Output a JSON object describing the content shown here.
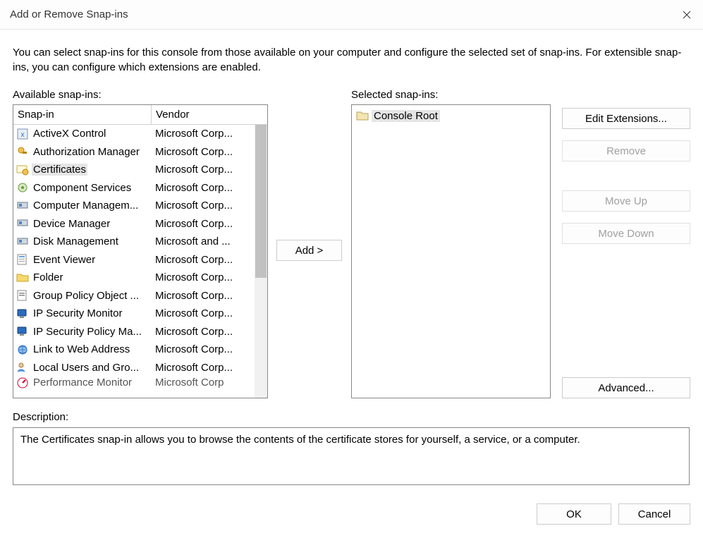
{
  "window": {
    "title": "Add or Remove Snap-ins"
  },
  "intro": "You can select snap-ins for this console from those available on your computer and configure the selected set of snap-ins. For extensible snap-ins, you can configure which extensions are enabled.",
  "labels": {
    "available": "Available snap-ins:",
    "selected": "Selected snap-ins:",
    "description": "Description:",
    "col_snapin": "Snap-in",
    "col_vendor": "Vendor"
  },
  "buttons": {
    "add": "Add >",
    "edit_ext": "Edit Extensions...",
    "remove": "Remove",
    "move_up": "Move Up",
    "move_down": "Move Down",
    "advanced": "Advanced...",
    "ok": "OK",
    "cancel": "Cancel"
  },
  "selected_tree": {
    "root": "Console Root"
  },
  "available_snapins": [
    {
      "name": "ActiveX Control",
      "vendor": "Microsoft Corp...",
      "icon": "activex-icon",
      "selected": false
    },
    {
      "name": "Authorization Manager",
      "vendor": "Microsoft Corp...",
      "icon": "authz-icon",
      "selected": false
    },
    {
      "name": "Certificates",
      "vendor": "Microsoft Corp...",
      "icon": "certificates-icon",
      "selected": true
    },
    {
      "name": "Component Services",
      "vendor": "Microsoft Corp...",
      "icon": "component-icon",
      "selected": false
    },
    {
      "name": "Computer Managem...",
      "vendor": "Microsoft Corp...",
      "icon": "computer-mgmt-icon",
      "selected": false
    },
    {
      "name": "Device Manager",
      "vendor": "Microsoft Corp...",
      "icon": "device-mgr-icon",
      "selected": false
    },
    {
      "name": "Disk Management",
      "vendor": "Microsoft and ...",
      "icon": "disk-mgmt-icon",
      "selected": false
    },
    {
      "name": "Event Viewer",
      "vendor": "Microsoft Corp...",
      "icon": "event-viewer-icon",
      "selected": false
    },
    {
      "name": "Folder",
      "vendor": "Microsoft Corp...",
      "icon": "folder-icon",
      "selected": false
    },
    {
      "name": "Group Policy Object ...",
      "vendor": "Microsoft Corp...",
      "icon": "gpo-icon",
      "selected": false
    },
    {
      "name": "IP Security Monitor",
      "vendor": "Microsoft Corp...",
      "icon": "ipsec-monitor-icon",
      "selected": false
    },
    {
      "name": "IP Security Policy Ma...",
      "vendor": "Microsoft Corp...",
      "icon": "ipsec-policy-icon",
      "selected": false
    },
    {
      "name": "Link to Web Address",
      "vendor": "Microsoft Corp...",
      "icon": "weblink-icon",
      "selected": false
    },
    {
      "name": "Local Users and Gro...",
      "vendor": "Microsoft Corp...",
      "icon": "local-users-icon",
      "selected": false
    },
    {
      "name": "Performance Monitor",
      "vendor": "Microsoft Corp",
      "icon": "perfmon-icon",
      "selected": false,
      "cut": true
    }
  ],
  "description": "The Certificates snap-in allows you to browse the contents of the certificate stores for yourself, a service, or a computer."
}
